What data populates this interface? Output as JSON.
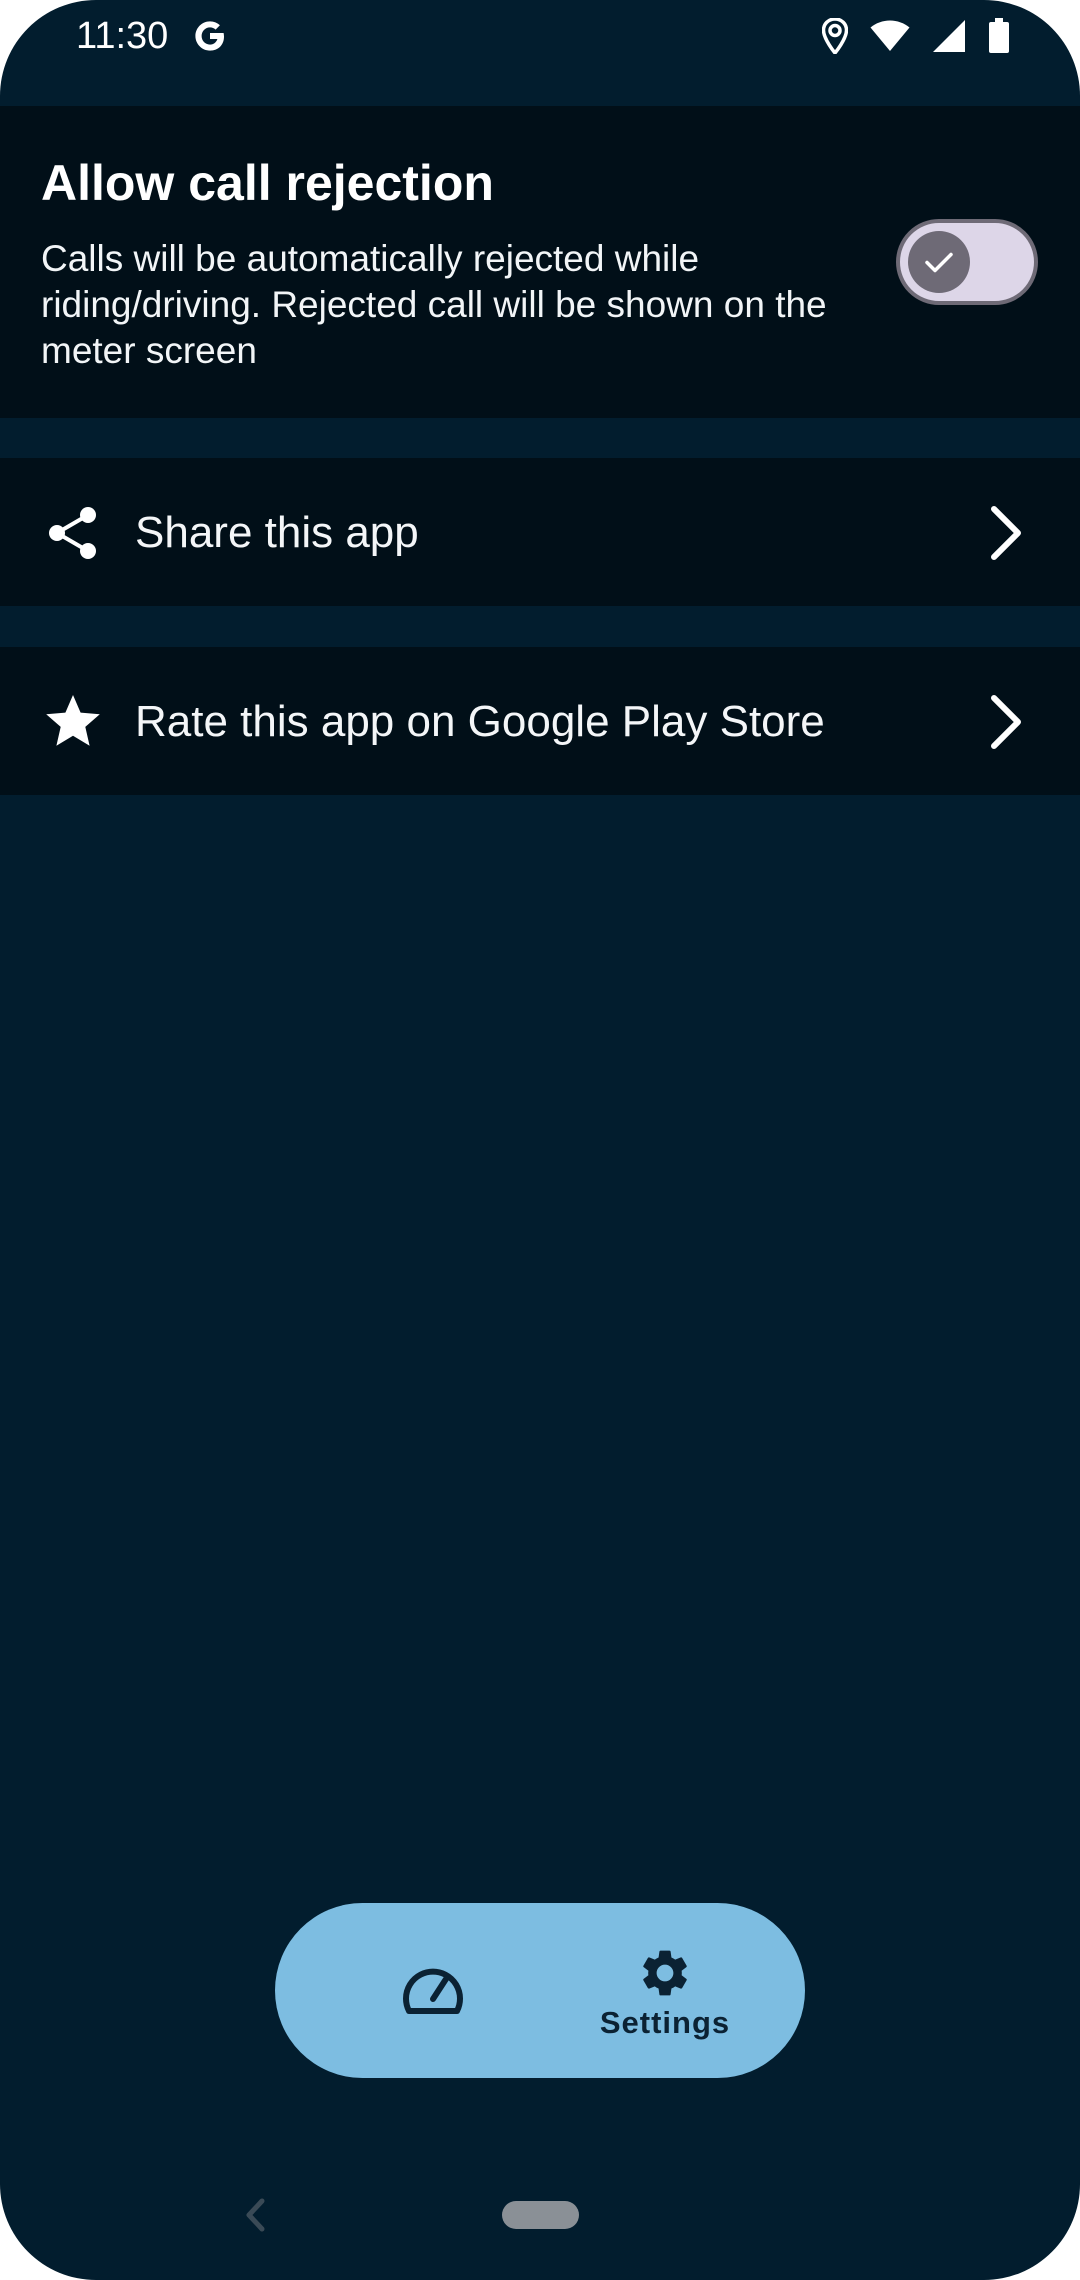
{
  "status_bar": {
    "time": "11:30",
    "icons": [
      "google-g-icon",
      "location-icon",
      "wifi-icon",
      "signal-icon",
      "battery-icon"
    ]
  },
  "call_rejection": {
    "title": "Allow call rejection",
    "description": "Calls will be automatically rejected while riding/driving. Rejected call will be shown on the meter screen",
    "toggle_on": true
  },
  "share_row": {
    "icon": "share-icon",
    "label": "Share this app"
  },
  "rate_row": {
    "icon": "star-icon",
    "label": "Rate this app on Google Play Store"
  },
  "bottom_nav": {
    "items": [
      {
        "icon": "speedometer-icon",
        "label": ""
      },
      {
        "icon": "gear-icon",
        "label": "Settings"
      }
    ],
    "active": "Settings"
  },
  "colors": {
    "background": "#021d2e",
    "card": "#010f18",
    "nav_pill": "#7dbde1",
    "toggle_track": "#ddd6e8",
    "toggle_thumb": "#6e6a76"
  }
}
